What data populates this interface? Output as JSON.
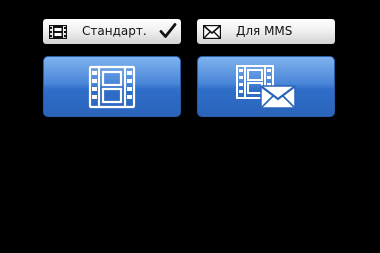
{
  "options": [
    {
      "label": "Стандарт.",
      "icon": "film-icon",
      "selected": true,
      "button_icon": "film-large-icon"
    },
    {
      "label": "Для MMS",
      "icon": "envelope-icon",
      "selected": false,
      "button_icon": "film-envelope-icon"
    }
  ],
  "colors": {
    "background": "#000000",
    "button_blue": "#3a78d0",
    "label_bar": "#f0f0f0"
  }
}
